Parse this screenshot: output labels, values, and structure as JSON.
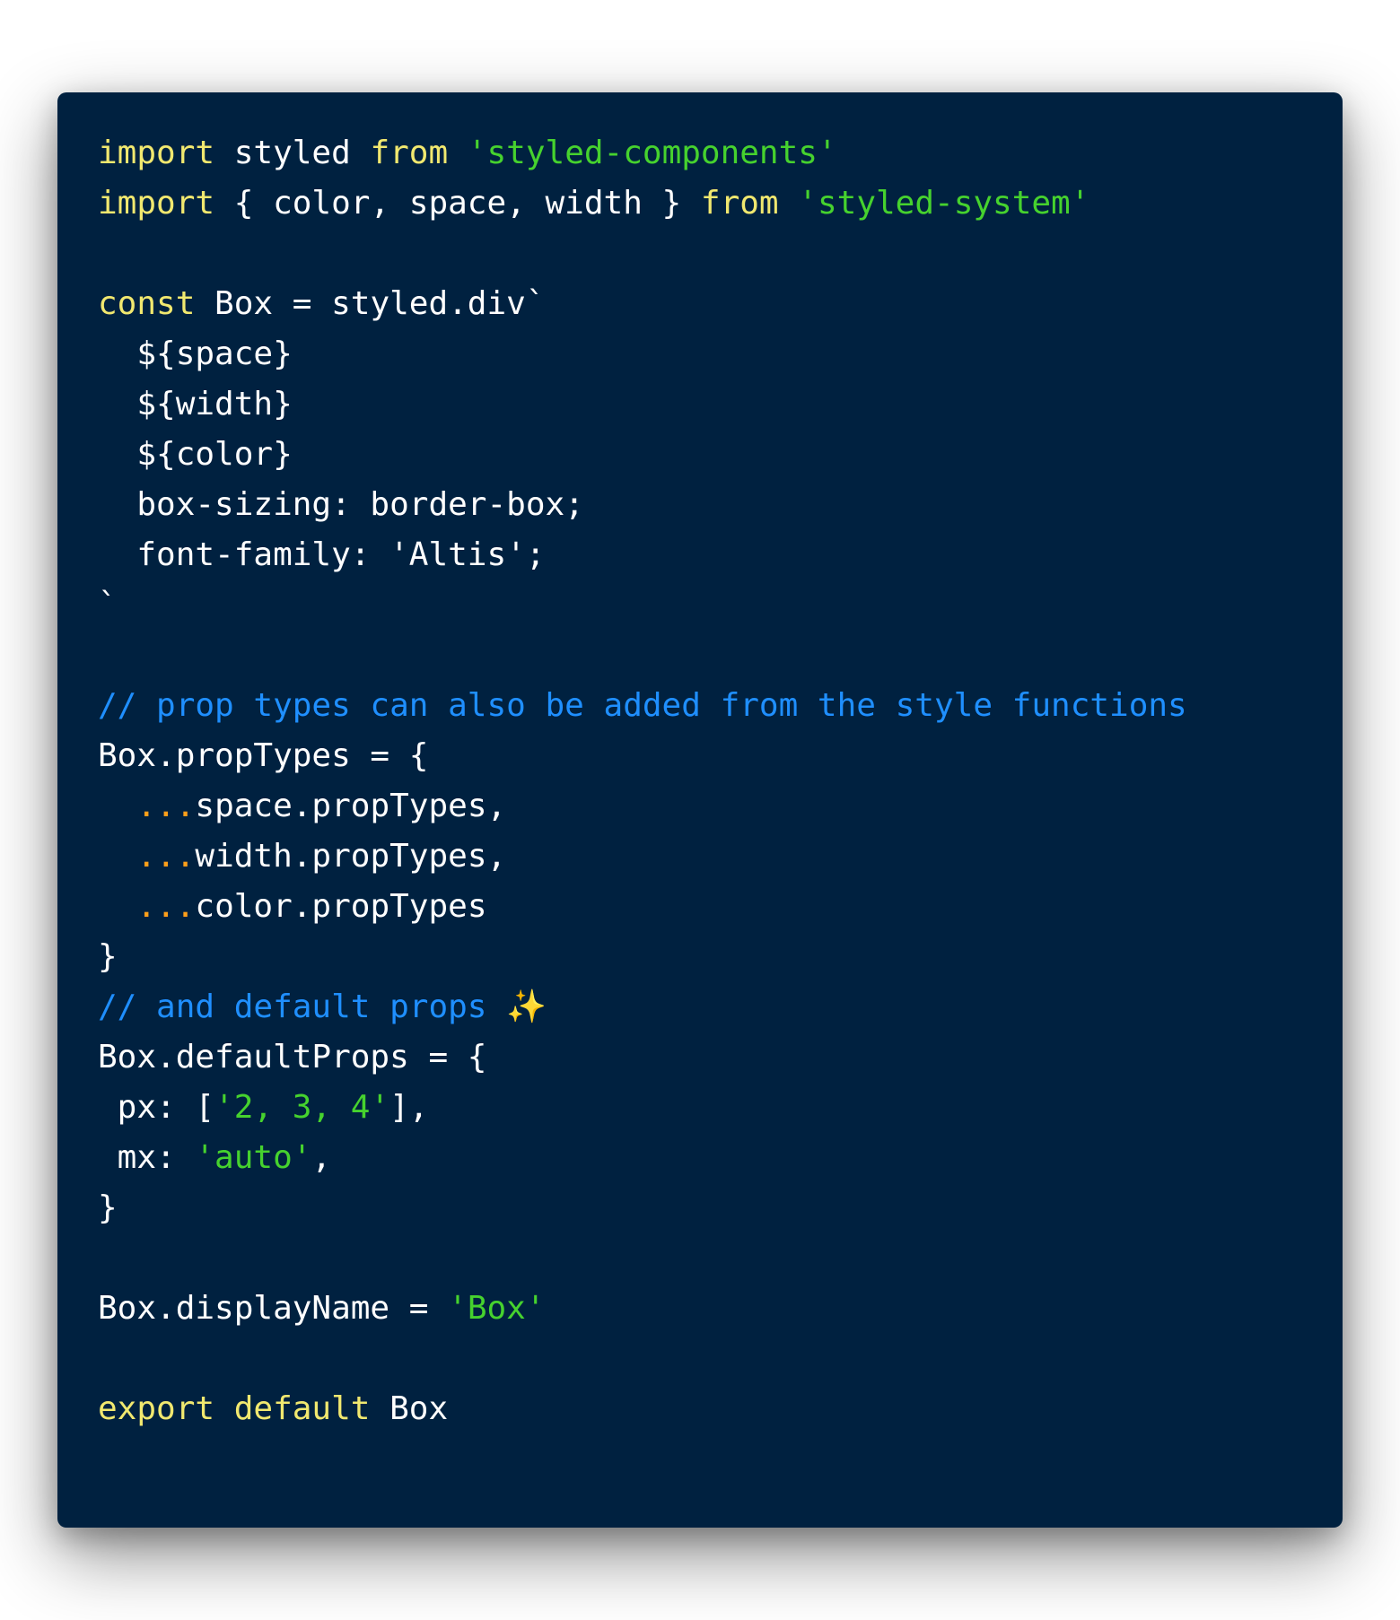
{
  "colors": {
    "background": "#002140",
    "keyword": "#f1e86f",
    "string": "#46d22e",
    "comment": "#1f8fff",
    "spread": "#ff9f1a",
    "plain": "#ffffff"
  },
  "lines": [
    [
      {
        "t": "kw",
        "v": "import"
      },
      {
        "t": "pl",
        "v": " styled "
      },
      {
        "t": "kw",
        "v": "from"
      },
      {
        "t": "pl",
        "v": " "
      },
      {
        "t": "str",
        "v": "'styled-components'"
      }
    ],
    [
      {
        "t": "kw",
        "v": "import"
      },
      {
        "t": "pl",
        "v": " { color, space, width } "
      },
      {
        "t": "kw",
        "v": "from"
      },
      {
        "t": "pl",
        "v": " "
      },
      {
        "t": "str",
        "v": "'styled-system'"
      }
    ],
    [],
    [
      {
        "t": "kw",
        "v": "const"
      },
      {
        "t": "pl",
        "v": " Box = styled.div`"
      }
    ],
    [
      {
        "t": "pl",
        "v": "  ${space}"
      }
    ],
    [
      {
        "t": "pl",
        "v": "  ${width}"
      }
    ],
    [
      {
        "t": "pl",
        "v": "  ${color}"
      }
    ],
    [
      {
        "t": "pl",
        "v": "  box-sizing: border-box;"
      }
    ],
    [
      {
        "t": "pl",
        "v": "  font-family: 'Altis';"
      }
    ],
    [
      {
        "t": "pl",
        "v": "`"
      }
    ],
    [],
    [
      {
        "t": "cm",
        "v": "// prop types can also be added from the style functions"
      }
    ],
    [
      {
        "t": "pl",
        "v": "Box.propTypes = {"
      }
    ],
    [
      {
        "t": "pl",
        "v": "  "
      },
      {
        "t": "sp",
        "v": "..."
      },
      {
        "t": "pl",
        "v": "space.propTypes,"
      }
    ],
    [
      {
        "t": "pl",
        "v": "  "
      },
      {
        "t": "sp",
        "v": "..."
      },
      {
        "t": "pl",
        "v": "width.propTypes,"
      }
    ],
    [
      {
        "t": "pl",
        "v": "  "
      },
      {
        "t": "sp",
        "v": "..."
      },
      {
        "t": "pl",
        "v": "color.propTypes"
      }
    ],
    [
      {
        "t": "pl",
        "v": "}"
      }
    ],
    [
      {
        "t": "cm",
        "v": "// and default props ✨"
      }
    ],
    [
      {
        "t": "pl",
        "v": "Box.defaultProps = {"
      }
    ],
    [
      {
        "t": "pl",
        "v": " px: ["
      },
      {
        "t": "str",
        "v": "'2, 3, 4'"
      },
      {
        "t": "pl",
        "v": "],"
      }
    ],
    [
      {
        "t": "pl",
        "v": " mx: "
      },
      {
        "t": "str",
        "v": "'auto'"
      },
      {
        "t": "pl",
        "v": ","
      }
    ],
    [
      {
        "t": "pl",
        "v": "}"
      }
    ],
    [],
    [
      {
        "t": "pl",
        "v": "Box.displayName = "
      },
      {
        "t": "str",
        "v": "'Box'"
      }
    ],
    [],
    [
      {
        "t": "kw",
        "v": "export"
      },
      {
        "t": "pl",
        "v": " "
      },
      {
        "t": "kw",
        "v": "default"
      },
      {
        "t": "pl",
        "v": " Box"
      }
    ]
  ]
}
